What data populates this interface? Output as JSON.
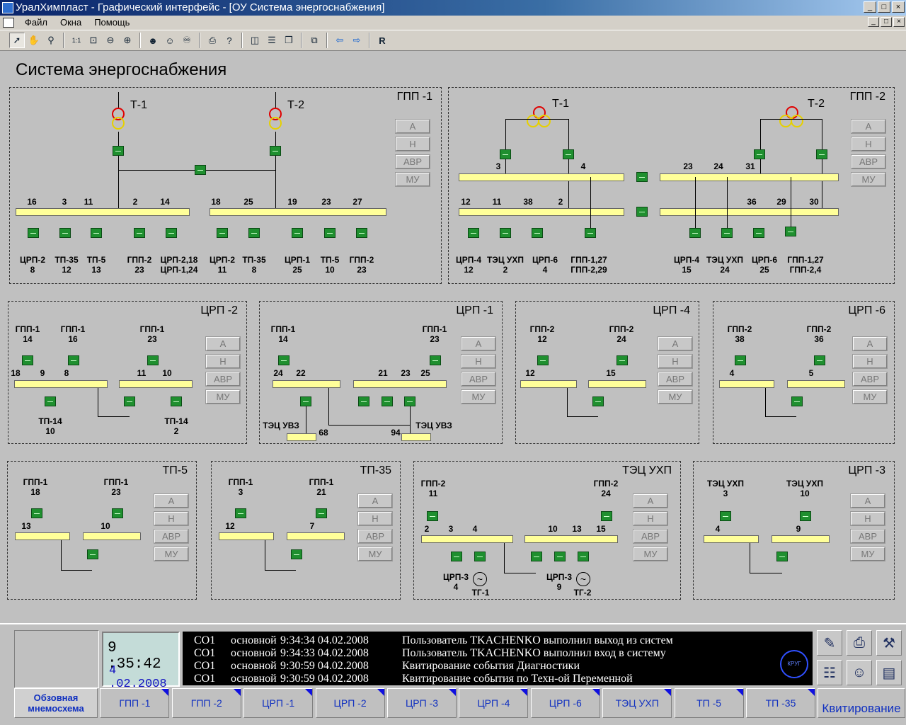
{
  "window": {
    "title": "УралХимпласт - Графический интерфейс - [ОУ Система энергоснабжения]",
    "min": "_",
    "max": "□",
    "close": "×"
  },
  "menu": [
    "Файл",
    "Окна",
    "Помощь"
  ],
  "toolbar": {
    "reset_label": "R",
    "icons": [
      "pointer-icon",
      "hand-icon",
      "magnifier-icon",
      "zoom-1-1-icon",
      "zoom-fit-icon",
      "zoom-out-icon",
      "zoom-in-icon",
      "users-icon",
      "users-lock-icon",
      "binoculars-icon",
      "print-icon",
      "help-icon",
      "layout-columns-icon",
      "layout-rows-icon",
      "cascade-icon",
      "window-link-icon",
      "back-arrow-icon",
      "forward-arrow-icon"
    ]
  },
  "page_title": "Система энергоснабжения",
  "mode_buttons": [
    "А",
    "Н",
    "АВР",
    "МУ"
  ],
  "panels": {
    "gpp1": {
      "title": "ГПП -1",
      "t1": "Т-1",
      "t2": "Т-2",
      "bus1": [
        "16",
        "3",
        "11",
        "2",
        "14"
      ],
      "bus2": [
        "18",
        "25",
        "19",
        "23",
        "27"
      ],
      "feeders": [
        [
          "ЦРП-2",
          "8"
        ],
        [
          "ТП-35",
          "12"
        ],
        [
          "ТП-5",
          "13"
        ],
        [
          "ГПП-2",
          "23"
        ],
        [
          "ЦРП-2,18",
          "ЦРП-1,24"
        ],
        [
          "ЦРП-2",
          "11"
        ],
        [
          "ТП-35",
          "8"
        ],
        [
          "ЦРП-1",
          "25"
        ],
        [
          "ТП-5",
          "10"
        ],
        [
          "ГПП-2",
          "23"
        ]
      ]
    },
    "gpp2": {
      "title": "ГПП -2",
      "t1": "Т-1",
      "t2": "Т-2",
      "top": [
        "3",
        "4",
        "23",
        "24",
        "31"
      ],
      "bot": [
        "12",
        "11",
        "38",
        "2",
        "36",
        "29",
        "30"
      ],
      "feeders": [
        [
          "ЦРП-4",
          "12"
        ],
        [
          "ТЭЦ УХП",
          "2"
        ],
        [
          "ЦРП-6",
          "4"
        ],
        [
          "ГПП-1,27",
          "ГПП-2,29"
        ],
        [
          "ЦРП-4",
          "15"
        ],
        [
          "ТЭЦ УХП",
          "24"
        ],
        [
          "ЦРП-6",
          "25"
        ],
        [
          "ГПП-1,27",
          "ГПП-2,4"
        ]
      ]
    },
    "crp2": {
      "title": "ЦРП -2",
      "in1": [
        "ГПП-1",
        "14"
      ],
      "in2": [
        "ГПП-1",
        "16"
      ],
      "in3": [
        "ГПП-1",
        "23"
      ],
      "nums": [
        "18",
        "9",
        "8",
        "11",
        "10"
      ],
      "out1": [
        "ТП-14",
        "10"
      ],
      "out2": [
        "ТП-14",
        "2"
      ]
    },
    "crp1": {
      "title": "ЦРП -1",
      "in1": [
        "ГПП-1",
        "14"
      ],
      "in2": [
        "ГПП-1",
        "23"
      ],
      "nums": [
        "24",
        "22",
        "21",
        "23",
        "25"
      ],
      "b1": "ТЭЦ УВЗ",
      "n1": "68",
      "n2": "94",
      "b2": "ТЭЦ УВЗ"
    },
    "crp4": {
      "title": "ЦРП -4",
      "in1": [
        "ГПП-2",
        "12"
      ],
      "in2": [
        "ГПП-2",
        "24"
      ],
      "nums": [
        "12",
        "15"
      ]
    },
    "crp6": {
      "title": "ЦРП -6",
      "in1": [
        "ГПП-2",
        "38"
      ],
      "in2": [
        "ГПП-2",
        "36"
      ],
      "nums": [
        "4",
        "5"
      ]
    },
    "tp5": {
      "title": "ТП-5",
      "in1": [
        "ГПП-1",
        "18"
      ],
      "in2": [
        "ГПП-1",
        "23"
      ],
      "nums": [
        "13",
        "10"
      ]
    },
    "tp35": {
      "title": "ТП-35",
      "in1": [
        "ГПП-1",
        "3"
      ],
      "in2": [
        "ГПП-1",
        "21"
      ],
      "nums": [
        "12",
        "7"
      ]
    },
    "tec": {
      "title": "ТЭЦ УХП",
      "in1": [
        "ГПП-2",
        "11"
      ],
      "in2": [
        "ГПП-2",
        "24"
      ],
      "nums": [
        "2",
        "3",
        "4",
        "10",
        "13",
        "15"
      ],
      "o1": [
        "ЦРП-3",
        "4"
      ],
      "g1": "ТГ-1",
      "o2": [
        "ЦРП-3",
        "9"
      ],
      "g2": "ТГ-2"
    },
    "crp3": {
      "title": "ЦРП -3",
      "in1": [
        "ТЭЦ УХП",
        "3"
      ],
      "in2": [
        "ТЭЦ УХП",
        "10"
      ],
      "nums": [
        "4",
        "9"
      ]
    }
  },
  "clock": {
    "time": "9 :35:42",
    "date": "4 .02.2008"
  },
  "log": [
    [
      "СО1",
      "основной",
      "9:34:34 04.02.2008",
      "Пользователь TKACHENKO выполнил выход из систем"
    ],
    [
      "СО1",
      "основной",
      "9:34:33 04.02.2008",
      "Пользователь TKACHENKO выполнил вход в систему"
    ],
    [
      "СО1",
      "основной",
      "9:30:59 04.02.2008",
      "Квитирование события Диагностики"
    ],
    [
      "СО1",
      "основной",
      "9:30:59 04.02.2008",
      "Квитирование события по Техн-ой Переменной"
    ]
  ],
  "logo_text": "КРУГ",
  "tabs": [
    "Обзовная мнемосхема",
    "ГПП -1",
    "ГПП -2",
    "ЦРП -1",
    "ЦРП -2",
    "ЦРП -3",
    "ЦРП -4",
    "ЦРП -6",
    "ТЭЦ УХП",
    "ТП -5",
    "ТП -35"
  ],
  "ack_label": "Квитирование",
  "colors": {
    "bus": "#ffff99",
    "switch": "#1f8f2f",
    "tab_text": "#1030c0",
    "log_bg": "#000000"
  }
}
